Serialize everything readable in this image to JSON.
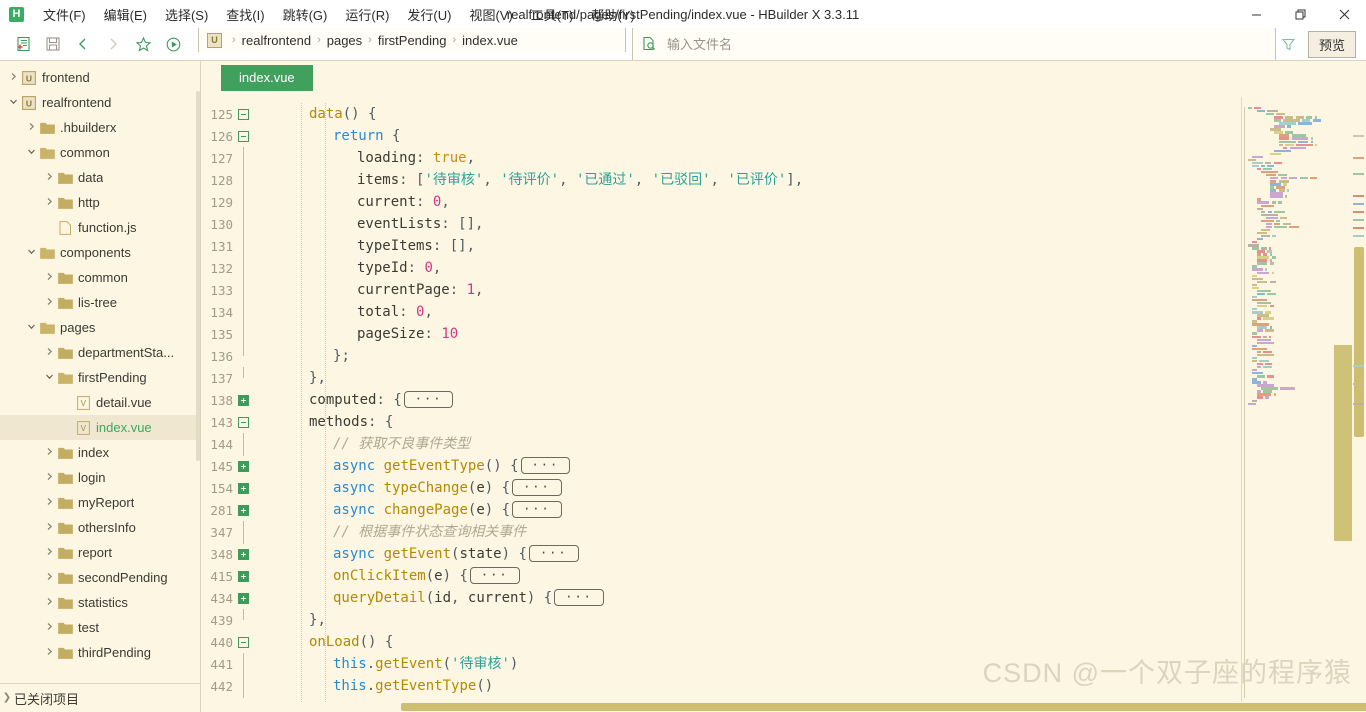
{
  "window": {
    "title": "realfrontend/pages/firstPending/index.vue - HBuilder X 3.3.11",
    "logo_letter": "H",
    "minimize": "—",
    "maximize": "❐",
    "close": "✕"
  },
  "menu": {
    "items": [
      {
        "label": "文件(F)",
        "name": "menu-file"
      },
      {
        "label": "编辑(E)",
        "name": "menu-edit"
      },
      {
        "label": "选择(S)",
        "name": "menu-select"
      },
      {
        "label": "查找(I)",
        "name": "menu-find"
      },
      {
        "label": "跳转(G)",
        "name": "menu-goto"
      },
      {
        "label": "运行(R)",
        "name": "menu-run"
      },
      {
        "label": "发行(U)",
        "name": "menu-publish"
      },
      {
        "label": "视图(V)",
        "name": "menu-view"
      },
      {
        "label": "工具(T)",
        "name": "menu-tools"
      },
      {
        "label": "帮助(Y)",
        "name": "menu-help"
      }
    ]
  },
  "toolbar": {
    "icons": [
      "new-file-icon",
      "save-icon",
      "back-arrow-icon",
      "forward-arrow-icon",
      "star-icon",
      "run-icon"
    ],
    "breadcrumb": {
      "project_badge": "U",
      "parts": [
        "realfrontend",
        "pages",
        "firstPending",
        "index.vue"
      ],
      "separator": "›"
    },
    "file_search": {
      "placeholder": "输入文件名",
      "value": ""
    },
    "filter_icon": "funnel-icon",
    "preview_label": "预览"
  },
  "sidebar": {
    "tree": [
      {
        "label": "frontend",
        "depth": 0,
        "type": "project",
        "state": "collapsed"
      },
      {
        "label": "realfrontend",
        "depth": 0,
        "type": "project",
        "state": "expanded"
      },
      {
        "label": ".hbuilderx",
        "depth": 1,
        "type": "folder",
        "state": "collapsed"
      },
      {
        "label": "common",
        "depth": 1,
        "type": "folder",
        "state": "expanded"
      },
      {
        "label": "data",
        "depth": 2,
        "type": "folder",
        "state": "collapsed"
      },
      {
        "label": "http",
        "depth": 2,
        "type": "folder",
        "state": "collapsed"
      },
      {
        "label": "function.js",
        "depth": 2,
        "type": "js",
        "state": "none"
      },
      {
        "label": "components",
        "depth": 1,
        "type": "folder",
        "state": "expanded"
      },
      {
        "label": "common",
        "depth": 2,
        "type": "folder",
        "state": "collapsed"
      },
      {
        "label": "lis-tree",
        "depth": 2,
        "type": "folder",
        "state": "collapsed"
      },
      {
        "label": "pages",
        "depth": 1,
        "type": "folder",
        "state": "expanded"
      },
      {
        "label": "departmentSta...",
        "depth": 2,
        "type": "folder",
        "state": "collapsed"
      },
      {
        "label": "firstPending",
        "depth": 2,
        "type": "folder",
        "state": "expanded"
      },
      {
        "label": "detail.vue",
        "depth": 3,
        "type": "vue",
        "state": "none"
      },
      {
        "label": "index.vue",
        "depth": 3,
        "type": "vue",
        "state": "none",
        "selected": true
      },
      {
        "label": "index",
        "depth": 2,
        "type": "folder",
        "state": "collapsed"
      },
      {
        "label": "login",
        "depth": 2,
        "type": "folder",
        "state": "collapsed"
      },
      {
        "label": "myReport",
        "depth": 2,
        "type": "folder",
        "state": "collapsed"
      },
      {
        "label": "othersInfo",
        "depth": 2,
        "type": "folder",
        "state": "collapsed"
      },
      {
        "label": "report",
        "depth": 2,
        "type": "folder",
        "state": "collapsed"
      },
      {
        "label": "secondPending",
        "depth": 2,
        "type": "folder",
        "state": "collapsed"
      },
      {
        "label": "statistics",
        "depth": 2,
        "type": "folder",
        "state": "collapsed"
      },
      {
        "label": "test",
        "depth": 2,
        "type": "folder",
        "state": "collapsed"
      },
      {
        "label": "thirdPending",
        "depth": 2,
        "type": "folder",
        "state": "collapsed"
      }
    ],
    "closed_projects": "已关闭项目"
  },
  "editor": {
    "tabs": [
      {
        "label": "index.vue",
        "active": true
      }
    ],
    "lines": [
      {
        "num": "125",
        "fold": "minus",
        "indent": 2,
        "text": "data() {"
      },
      {
        "num": "126",
        "fold": "minus",
        "indent": 3,
        "text": "return {"
      },
      {
        "num": "127",
        "fold": "bar",
        "indent": 4,
        "text": "loading: true,"
      },
      {
        "num": "128",
        "fold": "bar",
        "indent": 4,
        "text": "items: ['待审核', '待评价', '已通过', '已驳回', '已评价'],"
      },
      {
        "num": "129",
        "fold": "bar",
        "indent": 4,
        "text": "current: 0,"
      },
      {
        "num": "130",
        "fold": "bar",
        "indent": 4,
        "text": "eventLists: [],"
      },
      {
        "num": "131",
        "fold": "bar",
        "indent": 4,
        "text": "typeItems: [],"
      },
      {
        "num": "132",
        "fold": "bar",
        "indent": 4,
        "text": "typeId: 0,"
      },
      {
        "num": "133",
        "fold": "bar",
        "indent": 4,
        "text": "currentPage: 1,"
      },
      {
        "num": "134",
        "fold": "bar",
        "indent": 4,
        "text": "total: 0,"
      },
      {
        "num": "135",
        "fold": "bar",
        "indent": 4,
        "text": "pageSize: 10"
      },
      {
        "num": "136",
        "fold": "barend",
        "indent": 3,
        "text": "};"
      },
      {
        "num": "137",
        "fold": "barend",
        "indent": 2,
        "text": "},"
      },
      {
        "num": "138",
        "fold": "plus",
        "indent": 2,
        "text": "computed: { …"
      },
      {
        "num": "143",
        "fold": "minus",
        "indent": 2,
        "text": "methods: {"
      },
      {
        "num": "144",
        "fold": "bar",
        "indent": 3,
        "text": "// 获取不良事件类型"
      },
      {
        "num": "145",
        "fold": "plus",
        "indent": 3,
        "text": "async getEventType() { …"
      },
      {
        "num": "154",
        "fold": "plus",
        "indent": 3,
        "text": "async typeChange(e) { …"
      },
      {
        "num": "281",
        "fold": "plus",
        "indent": 3,
        "text": "async changePage(e) { …"
      },
      {
        "num": "347",
        "fold": "bar",
        "indent": 3,
        "text": "// 根据事件状态查询相关事件"
      },
      {
        "num": "348",
        "fold": "plus",
        "indent": 3,
        "text": "async getEvent(state) { …"
      },
      {
        "num": "415",
        "fold": "plus",
        "indent": 3,
        "text": "onClickItem(e) { …"
      },
      {
        "num": "434",
        "fold": "plus",
        "indent": 3,
        "text": "queryDetail(id, current) { …"
      },
      {
        "num": "439",
        "fold": "barend",
        "indent": 2,
        "text": "},"
      },
      {
        "num": "440",
        "fold": "minus",
        "indent": 2,
        "text": "onLoad() {"
      },
      {
        "num": "441",
        "fold": "bar",
        "indent": 3,
        "text": "this.getEvent('待审核')"
      },
      {
        "num": "442",
        "fold": "bar",
        "indent": 3,
        "text": "this.getEventType()"
      }
    ],
    "fold_placeholder": "···"
  },
  "watermark": "CSDN @一个双子座的程序猿",
  "colors": {
    "editor_background": "#fdf6e3",
    "tab_active": "#42a05f",
    "accent_green": "#3bab5f",
    "string": "#2aa198",
    "number": "#d33682",
    "keyword": "#268bd2",
    "function": "#b58900",
    "comment": "#b0a88f",
    "scrollbar": "#cdbe72"
  }
}
